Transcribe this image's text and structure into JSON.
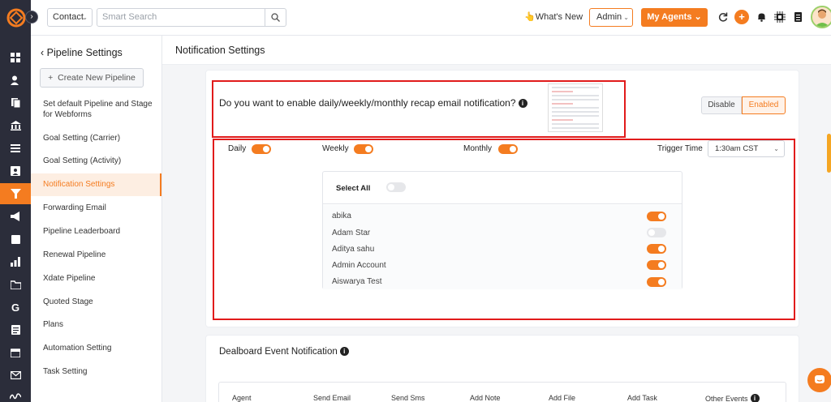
{
  "topbar": {
    "context_select": "Contact",
    "search_placeholder": "Smart Search",
    "whats_new": "What's New",
    "admin_select": "Admin",
    "my_agents": "My Agents"
  },
  "sub_sidebar": {
    "title": "Pipeline Settings",
    "new_button": "Create New Pipeline",
    "items": [
      {
        "label": "Set default Pipeline and Stage for Webforms"
      },
      {
        "label": "Goal Setting (Carrier)"
      },
      {
        "label": "Goal Setting (Activity)"
      },
      {
        "label": "Notification Settings"
      },
      {
        "label": "Forwarding Email"
      },
      {
        "label": "Pipeline Leaderboard"
      },
      {
        "label": "Renewal Pipeline"
      },
      {
        "label": "Xdate Pipeline"
      },
      {
        "label": "Quoted Stage"
      },
      {
        "label": "Plans"
      },
      {
        "label": "Automation Setting"
      },
      {
        "label": "Task Setting"
      }
    ],
    "active_index": 3
  },
  "content": {
    "title": "Notification Settings",
    "recap": {
      "question": "Do you want to enable daily/weekly/monthly recap email notification?",
      "disable_label": "Disable",
      "enabled_label": "Enabled",
      "daily_label": "Daily",
      "weekly_label": "Weekly",
      "monthly_label": "Monthly",
      "daily_on": true,
      "weekly_on": true,
      "monthly_on": true,
      "trigger_label": "Trigger Time",
      "trigger_value": "1:30am CST",
      "select_all_label": "Select All",
      "select_all_on": false,
      "agents": [
        {
          "name": "abika",
          "on": true
        },
        {
          "name": "Adam Star",
          "on": false
        },
        {
          "name": "Aditya sahu",
          "on": true
        },
        {
          "name": "Admin Account",
          "on": true
        },
        {
          "name": "Aiswarya Test",
          "on": true
        }
      ]
    },
    "dealboard": {
      "title": "Dealboard Event Notification",
      "columns": [
        "Agent",
        "Send Email",
        "Send Sms",
        "Add Note",
        "Add File",
        "Add Task",
        "Other Events"
      ]
    }
  },
  "colors": {
    "accent": "#f47c20",
    "highlight_box": "#e11b1b",
    "rail_bg": "#2b2d3a"
  }
}
